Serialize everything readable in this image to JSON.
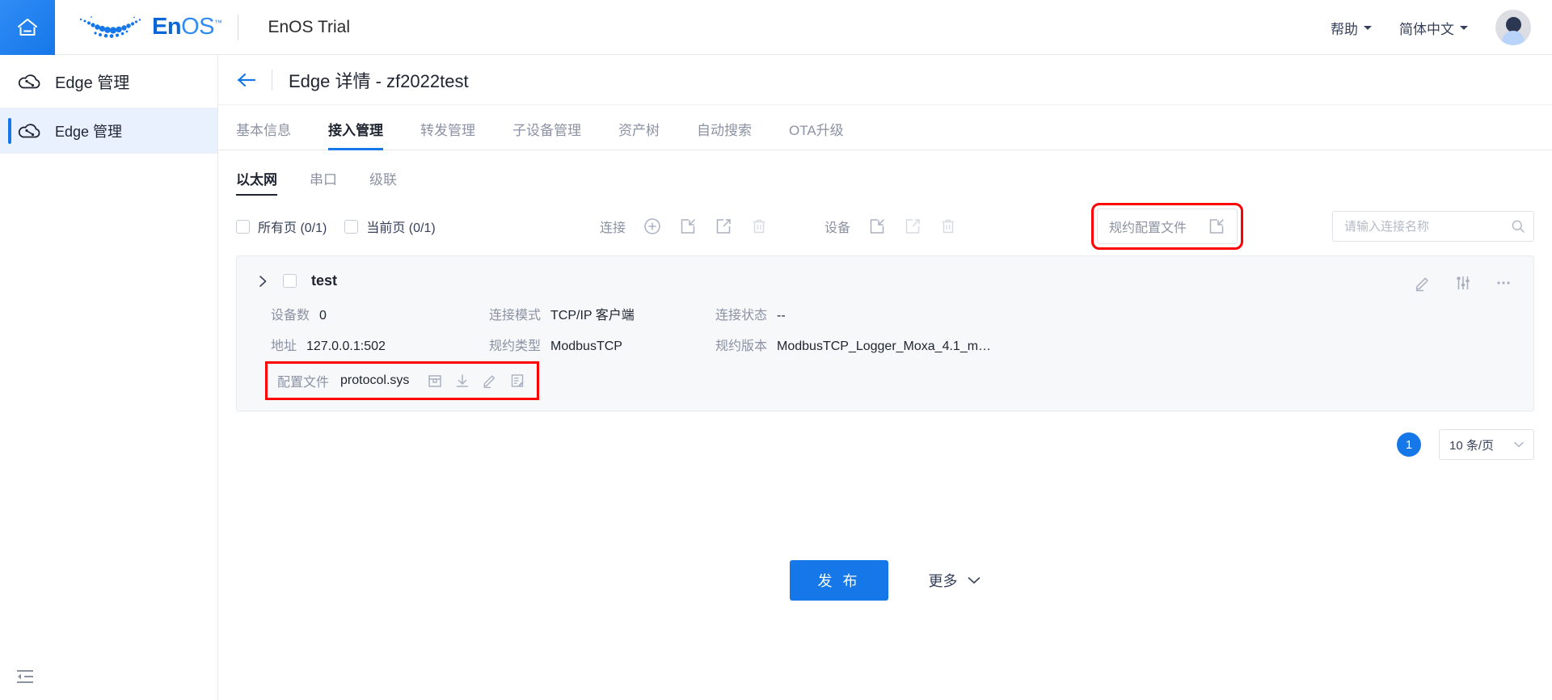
{
  "header": {
    "home_icon": "home-icon",
    "logo_text_en": "En",
    "logo_text_os": "OS",
    "logo_tm": "™",
    "app_title": "EnOS Trial",
    "help_label": "帮助",
    "language_label": "简体中文",
    "avatar": "user-avatar"
  },
  "sidebar": {
    "header_label": "Edge 管理",
    "items": [
      {
        "label": "Edge 管理",
        "icon": "cloud-edge-icon",
        "active": true
      }
    ],
    "collapse_icon": "collapse-sidebar-icon"
  },
  "page": {
    "back_icon": "back-arrow-icon",
    "title": "Edge 详情 - zf2022test"
  },
  "tabs": [
    {
      "label": "基本信息",
      "active": false
    },
    {
      "label": "接入管理",
      "active": true
    },
    {
      "label": "转发管理",
      "active": false
    },
    {
      "label": "子设备管理",
      "active": false
    },
    {
      "label": "资产树",
      "active": false
    },
    {
      "label": "自动搜索",
      "active": false
    },
    {
      "label": "OTA升级",
      "active": false
    }
  ],
  "subtabs": [
    {
      "label": "以太网",
      "active": true
    },
    {
      "label": "串口",
      "active": false
    },
    {
      "label": "级联",
      "active": false
    }
  ],
  "toolbar": {
    "select_all_pages": "所有页 (0/1)",
    "select_current_page": "当前页 (0/1)",
    "connection_label": "连接",
    "device_label": "设备",
    "connection_actions": [
      "add-circle-icon",
      "import-icon",
      "export-icon",
      "delete-icon"
    ],
    "device_actions": [
      "import-icon",
      "export-icon",
      "delete-icon"
    ],
    "protocol_config_label": "规约配置文件",
    "protocol_config_icon": "import-icon",
    "protocol_config_highlighted": true,
    "search_placeholder": "请输入连接名称",
    "search_value": "",
    "search_icon": "search-icon"
  },
  "card": {
    "expand_icon": "chevron-right-icon",
    "checked": false,
    "name": "test",
    "actions": [
      "edit-pencil-icon",
      "settings-sliders-icon",
      "more-ellipsis-icon"
    ],
    "fields": [
      {
        "key": "设备数",
        "value": "0"
      },
      {
        "key": "连接模式",
        "value": "TCP/IP 客户端"
      },
      {
        "key": "连接状态",
        "value": "--"
      },
      {
        "key": "地址",
        "value": "127.0.0.1:502"
      },
      {
        "key": "规约类型",
        "value": "ModbusTCP"
      },
      {
        "key": "规约版本",
        "value": "ModbusTCP_Logger_Moxa_4.1_m…"
      }
    ],
    "config_file": {
      "key": "配置文件",
      "value": "protocol.sys",
      "highlighted": true,
      "actions": [
        "upload-box-icon",
        "download-icon",
        "edit-pencil-icon",
        "document-edit-icon"
      ]
    }
  },
  "pagination": {
    "current_page": "1",
    "page_size_label": "10 条/页",
    "chevron_icon": "chevron-down-icon"
  },
  "footer": {
    "publish_label": "发 布",
    "more_label": "更多",
    "more_icon": "chevron-down-icon"
  },
  "colors": {
    "accent": "#1677e8",
    "highlight": "#ff0000",
    "muted": "#8b92a3",
    "card_bg": "#f7f8fa"
  }
}
